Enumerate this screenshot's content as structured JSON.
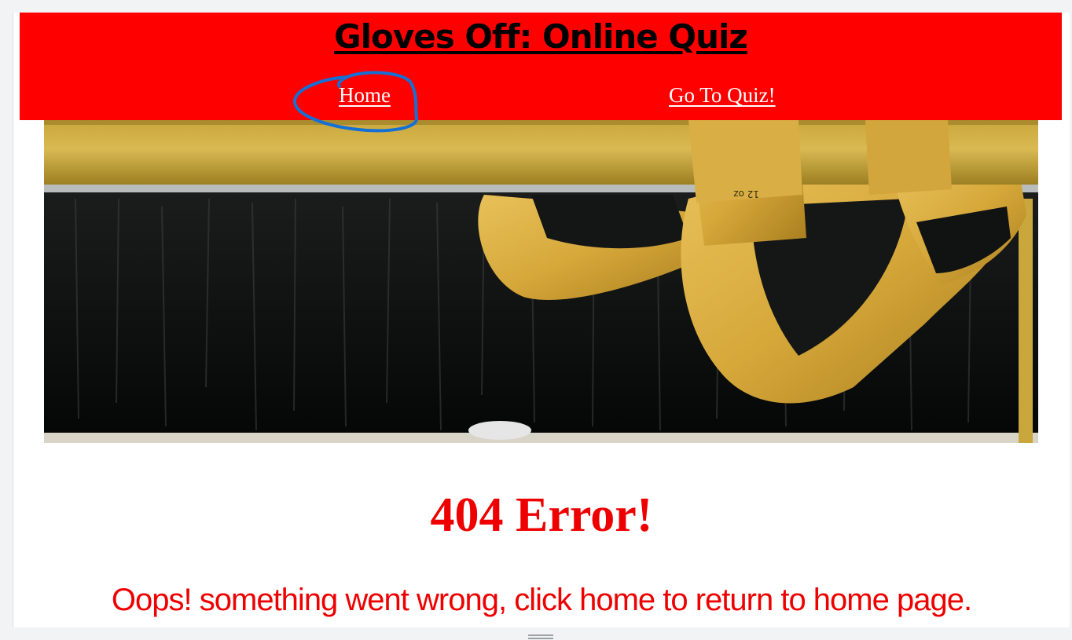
{
  "header": {
    "title": "Gloves Off: Online Quiz",
    "background_color": "#ff0000"
  },
  "nav": {
    "home_label": "Home",
    "quiz_label": "Go To Quiz!"
  },
  "hero": {
    "image_subject": "yellow boxing gloves hanging over a wooden rail"
  },
  "main": {
    "heading": "404 Error!",
    "message": "Oops! something went wrong, click home to return to home page."
  },
  "colors": {
    "accent": "#ff0000",
    "error_text": "#ee0000",
    "annotation": "#1570d6"
  }
}
